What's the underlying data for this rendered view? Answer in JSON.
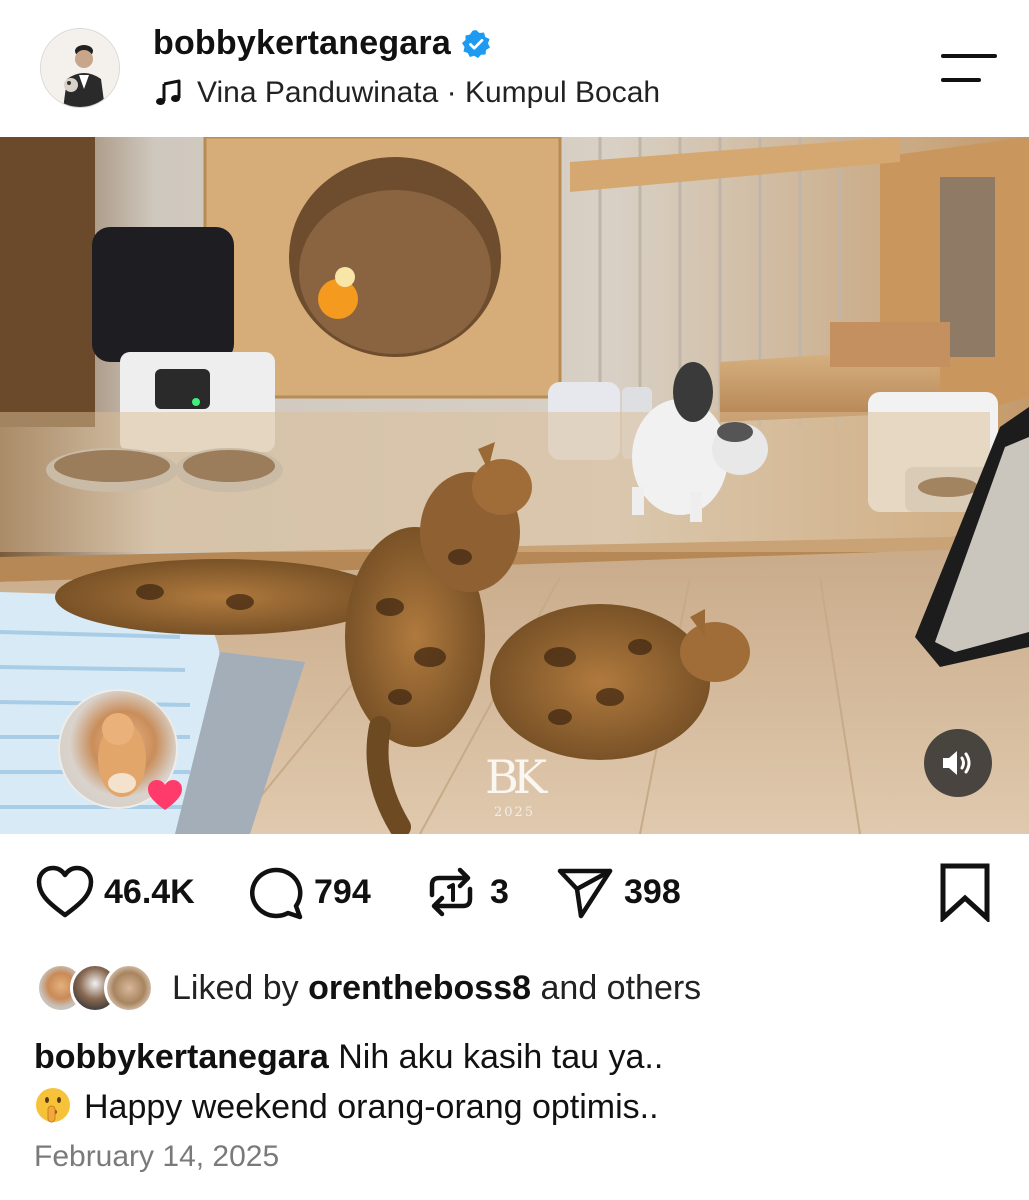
{
  "header": {
    "username": "bobbykertanegara",
    "music": "Vina Panduwinata · Kumpul Bocah"
  },
  "photo": {
    "watermark": "BK",
    "watermark_year": "2025"
  },
  "actions": {
    "likes": "46.4K",
    "comments": "794",
    "reposts": "3",
    "shares": "398"
  },
  "liked_by": {
    "prefix": "Liked by",
    "user": "orentheboss8",
    "suffix": "and others"
  },
  "caption": {
    "username": "bobbykertanegara",
    "line1": "Nih aku kasih tau ya..",
    "line2": "Happy weekend orang-orang optimis.."
  },
  "date": "February 14, 2025",
  "colors": {
    "verified": "#1d9bf0",
    "heart_badge": "#ff3b6b",
    "date_text": "#7a7a7a"
  },
  "icons": [
    "verified-icon",
    "music-note-icon",
    "menu-icon",
    "heart-icon",
    "comment-icon",
    "repost-icon",
    "send-icon",
    "bookmark-icon",
    "sound-icon",
    "shush-emoji-icon"
  ]
}
